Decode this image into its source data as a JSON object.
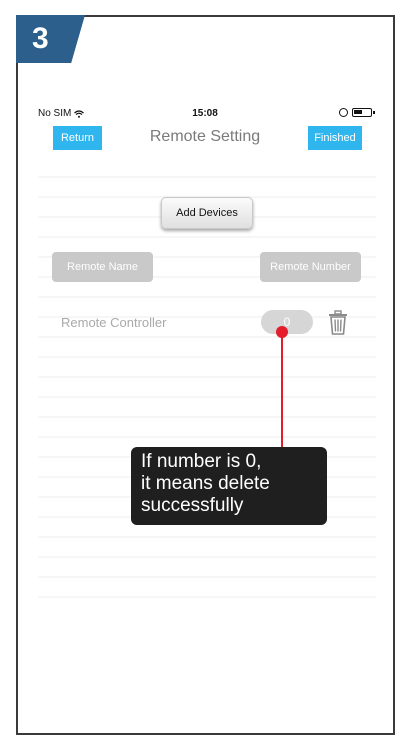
{
  "step": {
    "number": "3"
  },
  "status_bar": {
    "carrier": "No SIM",
    "time": "15:08"
  },
  "nav": {
    "return_label": "Return",
    "title": "Remote Setting",
    "finished_label": "Finished"
  },
  "main": {
    "add_devices_label": "Add Devices",
    "remote_name_label": "Remote Name",
    "remote_number_label": "Remote Number",
    "remote_row": {
      "name": "Remote Controller",
      "number": "0"
    }
  },
  "callout": {
    "lines": [
      "If number is 0,",
      "it means delete",
      "successfully"
    ]
  },
  "colors": {
    "step_badge": "#2d5f8c",
    "nav_button": "#2fb6ef",
    "pointer": "#e41c2c",
    "callout_bg": "#1f1f1f"
  },
  "icons": [
    "wifi-icon",
    "lock-rotation-icon",
    "battery-icon",
    "trash-icon"
  ]
}
